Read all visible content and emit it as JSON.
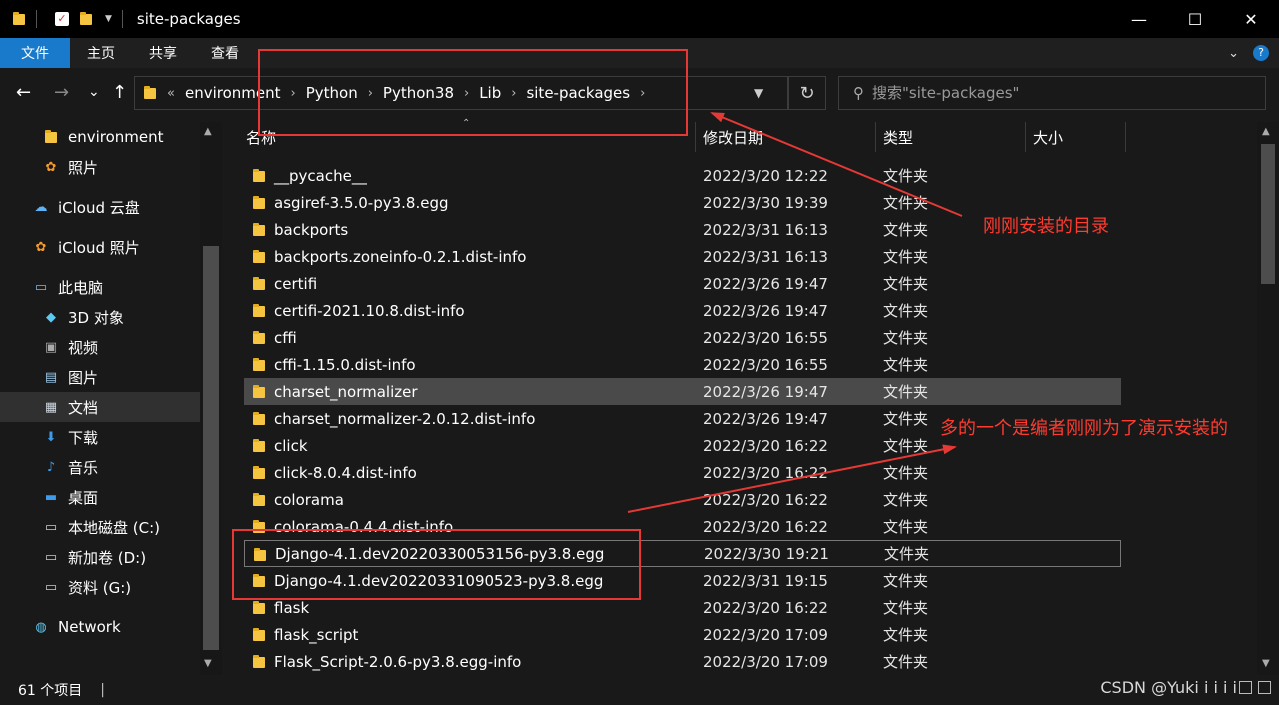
{
  "window": {
    "title": "site-packages",
    "controls": {
      "minimize": "—",
      "maximize": "☐",
      "close": "✕"
    }
  },
  "ribbon": {
    "tabs": [
      "文件",
      "主页",
      "共享",
      "查看"
    ],
    "help": "?"
  },
  "nav": {
    "back": "←",
    "forward": "→",
    "recent": "⌄",
    "up": "↑",
    "overflow": "«",
    "breadcrumbs": [
      "environment",
      "Python",
      "Python38",
      "Lib",
      "site-packages"
    ],
    "refresh": "↻",
    "search_placeholder": "搜索\"site-packages\""
  },
  "sidebar": {
    "items": [
      {
        "label": "environment",
        "icon": "folder-icon"
      },
      {
        "label": "照片",
        "icon": "photos-icon"
      },
      {
        "label": "iCloud 云盘",
        "icon": "icloud-icon"
      },
      {
        "label": "iCloud 照片",
        "icon": "icloud-photos-icon"
      },
      {
        "label": "此电脑",
        "icon": "computer-icon"
      },
      {
        "label": "3D 对象",
        "icon": "3d-objects-icon"
      },
      {
        "label": "视频",
        "icon": "videos-icon"
      },
      {
        "label": "图片",
        "icon": "pictures-icon"
      },
      {
        "label": "文档",
        "icon": "documents-icon"
      },
      {
        "label": "下载",
        "icon": "downloads-icon"
      },
      {
        "label": "音乐",
        "icon": "music-icon"
      },
      {
        "label": "桌面",
        "icon": "desktop-icon"
      },
      {
        "label": "本地磁盘 (C:)",
        "icon": "drive-icon"
      },
      {
        "label": "新加卷 (D:)",
        "icon": "drive-icon"
      },
      {
        "label": "资料 (G:)",
        "icon": "drive-icon"
      },
      {
        "label": "Network",
        "icon": "network-icon"
      }
    ]
  },
  "columns": {
    "name": "名称",
    "modified": "修改日期",
    "type": "类型",
    "size": "大小"
  },
  "files": [
    {
      "name": "__pycache__",
      "date": "2022/3/20 12:22",
      "type": "文件夹"
    },
    {
      "name": "asgiref-3.5.0-py3.8.egg",
      "date": "2022/3/30 19:39",
      "type": "文件夹"
    },
    {
      "name": "backports",
      "date": "2022/3/31 16:13",
      "type": "文件夹"
    },
    {
      "name": "backports.zoneinfo-0.2.1.dist-info",
      "date": "2022/3/31 16:13",
      "type": "文件夹"
    },
    {
      "name": "certifi",
      "date": "2022/3/26 19:47",
      "type": "文件夹"
    },
    {
      "name": "certifi-2021.10.8.dist-info",
      "date": "2022/3/26 19:47",
      "type": "文件夹"
    },
    {
      "name": "cffi",
      "date": "2022/3/20 16:55",
      "type": "文件夹"
    },
    {
      "name": "cffi-1.15.0.dist-info",
      "date": "2022/3/20 16:55",
      "type": "文件夹"
    },
    {
      "name": "charset_normalizer",
      "date": "2022/3/26 19:47",
      "type": "文件夹"
    },
    {
      "name": "charset_normalizer-2.0.12.dist-info",
      "date": "2022/3/26 19:47",
      "type": "文件夹"
    },
    {
      "name": "click",
      "date": "2022/3/20 16:22",
      "type": "文件夹"
    },
    {
      "name": "click-8.0.4.dist-info",
      "date": "2022/3/20 16:22",
      "type": "文件夹"
    },
    {
      "name": "colorama",
      "date": "2022/3/20 16:22",
      "type": "文件夹"
    },
    {
      "name": "colorama-0.4.4.dist-info",
      "date": "2022/3/20 16:22",
      "type": "文件夹"
    },
    {
      "name": "Django-4.1.dev20220330053156-py3.8.egg",
      "date": "2022/3/30 19:21",
      "type": "文件夹"
    },
    {
      "name": "Django-4.1.dev20220331090523-py3.8.egg",
      "date": "2022/3/31 19:15",
      "type": "文件夹"
    },
    {
      "name": "flask",
      "date": "2022/3/20 16:22",
      "type": "文件夹"
    },
    {
      "name": "flask_script",
      "date": "2022/3/20 17:09",
      "type": "文件夹"
    },
    {
      "name": "Flask_Script-2.0.6-py3.8.egg-info",
      "date": "2022/3/20 17:09",
      "type": "文件夹"
    }
  ],
  "status": {
    "count": "61 个项目",
    "divider": "|",
    "watermark": "CSDN @Yuki i i i i"
  },
  "annotations": {
    "path_note": "刚刚安装的目录",
    "django_note": "多的一个是编者刚刚为了演示安装的",
    "color": "#e53935"
  },
  "colors": {
    "accent": "#1979ca",
    "folder": "#f5c542",
    "selected_row": "#4a4a4a"
  }
}
